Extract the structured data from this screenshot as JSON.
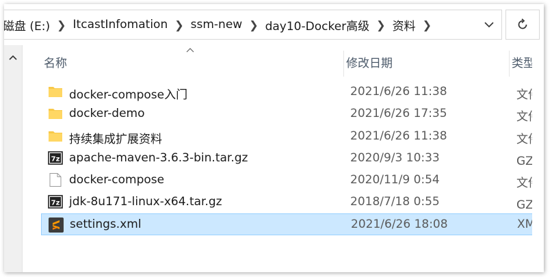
{
  "breadcrumb": {
    "items": [
      "磁盘 (E:)",
      "ItcastInfomation",
      "ssm-new",
      "day10-Docker高级",
      "资料"
    ]
  },
  "columns": {
    "name": "名称",
    "date": "修改日期",
    "type": "类型"
  },
  "icons": {
    "folder": "folder-icon",
    "archive": "7z-archive-icon",
    "file": "blank-file-icon",
    "xml": "sublime-text-icon",
    "refresh": "refresh-icon",
    "dropdown": "chevron-down-icon",
    "scroll_up": "chevron-up-icon",
    "sort": "sort-ascending-icon"
  },
  "colors": {
    "folder": "#f8c94a",
    "selection_bg": "#cce8ff",
    "selection_border": "#99d1ff",
    "header_text": "#4c5a6a"
  },
  "files": [
    {
      "name": "docker-compose入门",
      "date": "2021/6/26 11:38",
      "type": "文件夹",
      "icon": "folder"
    },
    {
      "name": "docker-demo",
      "date": "2021/6/26 17:35",
      "type": "文件夹",
      "icon": "folder"
    },
    {
      "name": "持续集成扩展资料",
      "date": "2021/6/26 11:38",
      "type": "文件夹",
      "icon": "folder"
    },
    {
      "name": "apache-maven-3.6.3-bin.tar.gz",
      "date": "2020/9/3 10:33",
      "type": "GZ 文",
      "icon": "archive"
    },
    {
      "name": "docker-compose",
      "date": "2020/11/9 0:54",
      "type": "文件",
      "icon": "file"
    },
    {
      "name": "jdk-8u171-linux-x64.tar.gz",
      "date": "2018/7/18 0:55",
      "type": "GZ 文",
      "icon": "archive"
    },
    {
      "name": "settings.xml",
      "date": "2021/6/26 18:08",
      "type": "XML",
      "icon": "xml",
      "selected": true
    }
  ]
}
